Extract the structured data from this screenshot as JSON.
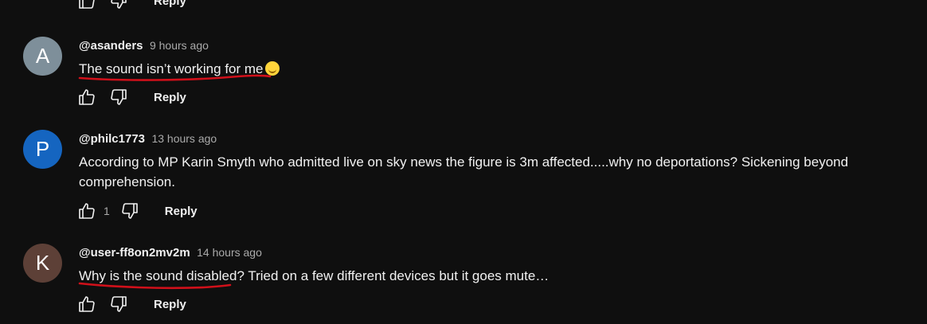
{
  "top": {
    "reply_label": "Reply"
  },
  "comments": [
    {
      "avatar_letter": "A",
      "avatar_color": "#7e8f9a",
      "handle": "@asanders",
      "time": "9 hours ago",
      "text": "The sound isn’t working for me",
      "emoji": "smiling-face-emoji",
      "like_count": "",
      "reply_label": "Reply"
    },
    {
      "avatar_letter": "P",
      "avatar_color": "#1565c0",
      "handle": "@philc1773",
      "time": "13 hours ago",
      "text": "According to MP Karin Smyth who admitted live on sky news the figure is 3m affected.....why no deportations? Sickening beyond comprehension.",
      "like_count": "1",
      "reply_label": "Reply"
    },
    {
      "avatar_letter": "K",
      "avatar_color": "#5d4037",
      "handle": "@user-ff8on2mv2m",
      "time": "14 hours ago",
      "text": "Why is the sound disabled? Tried on a few different devices but it goes mute…",
      "like_count": "",
      "reply_label": "Reply"
    }
  ],
  "annotation_color": "#d0101a",
  "icons": {
    "like": "thumbs-up-icon",
    "dislike": "thumbs-down-icon"
  }
}
